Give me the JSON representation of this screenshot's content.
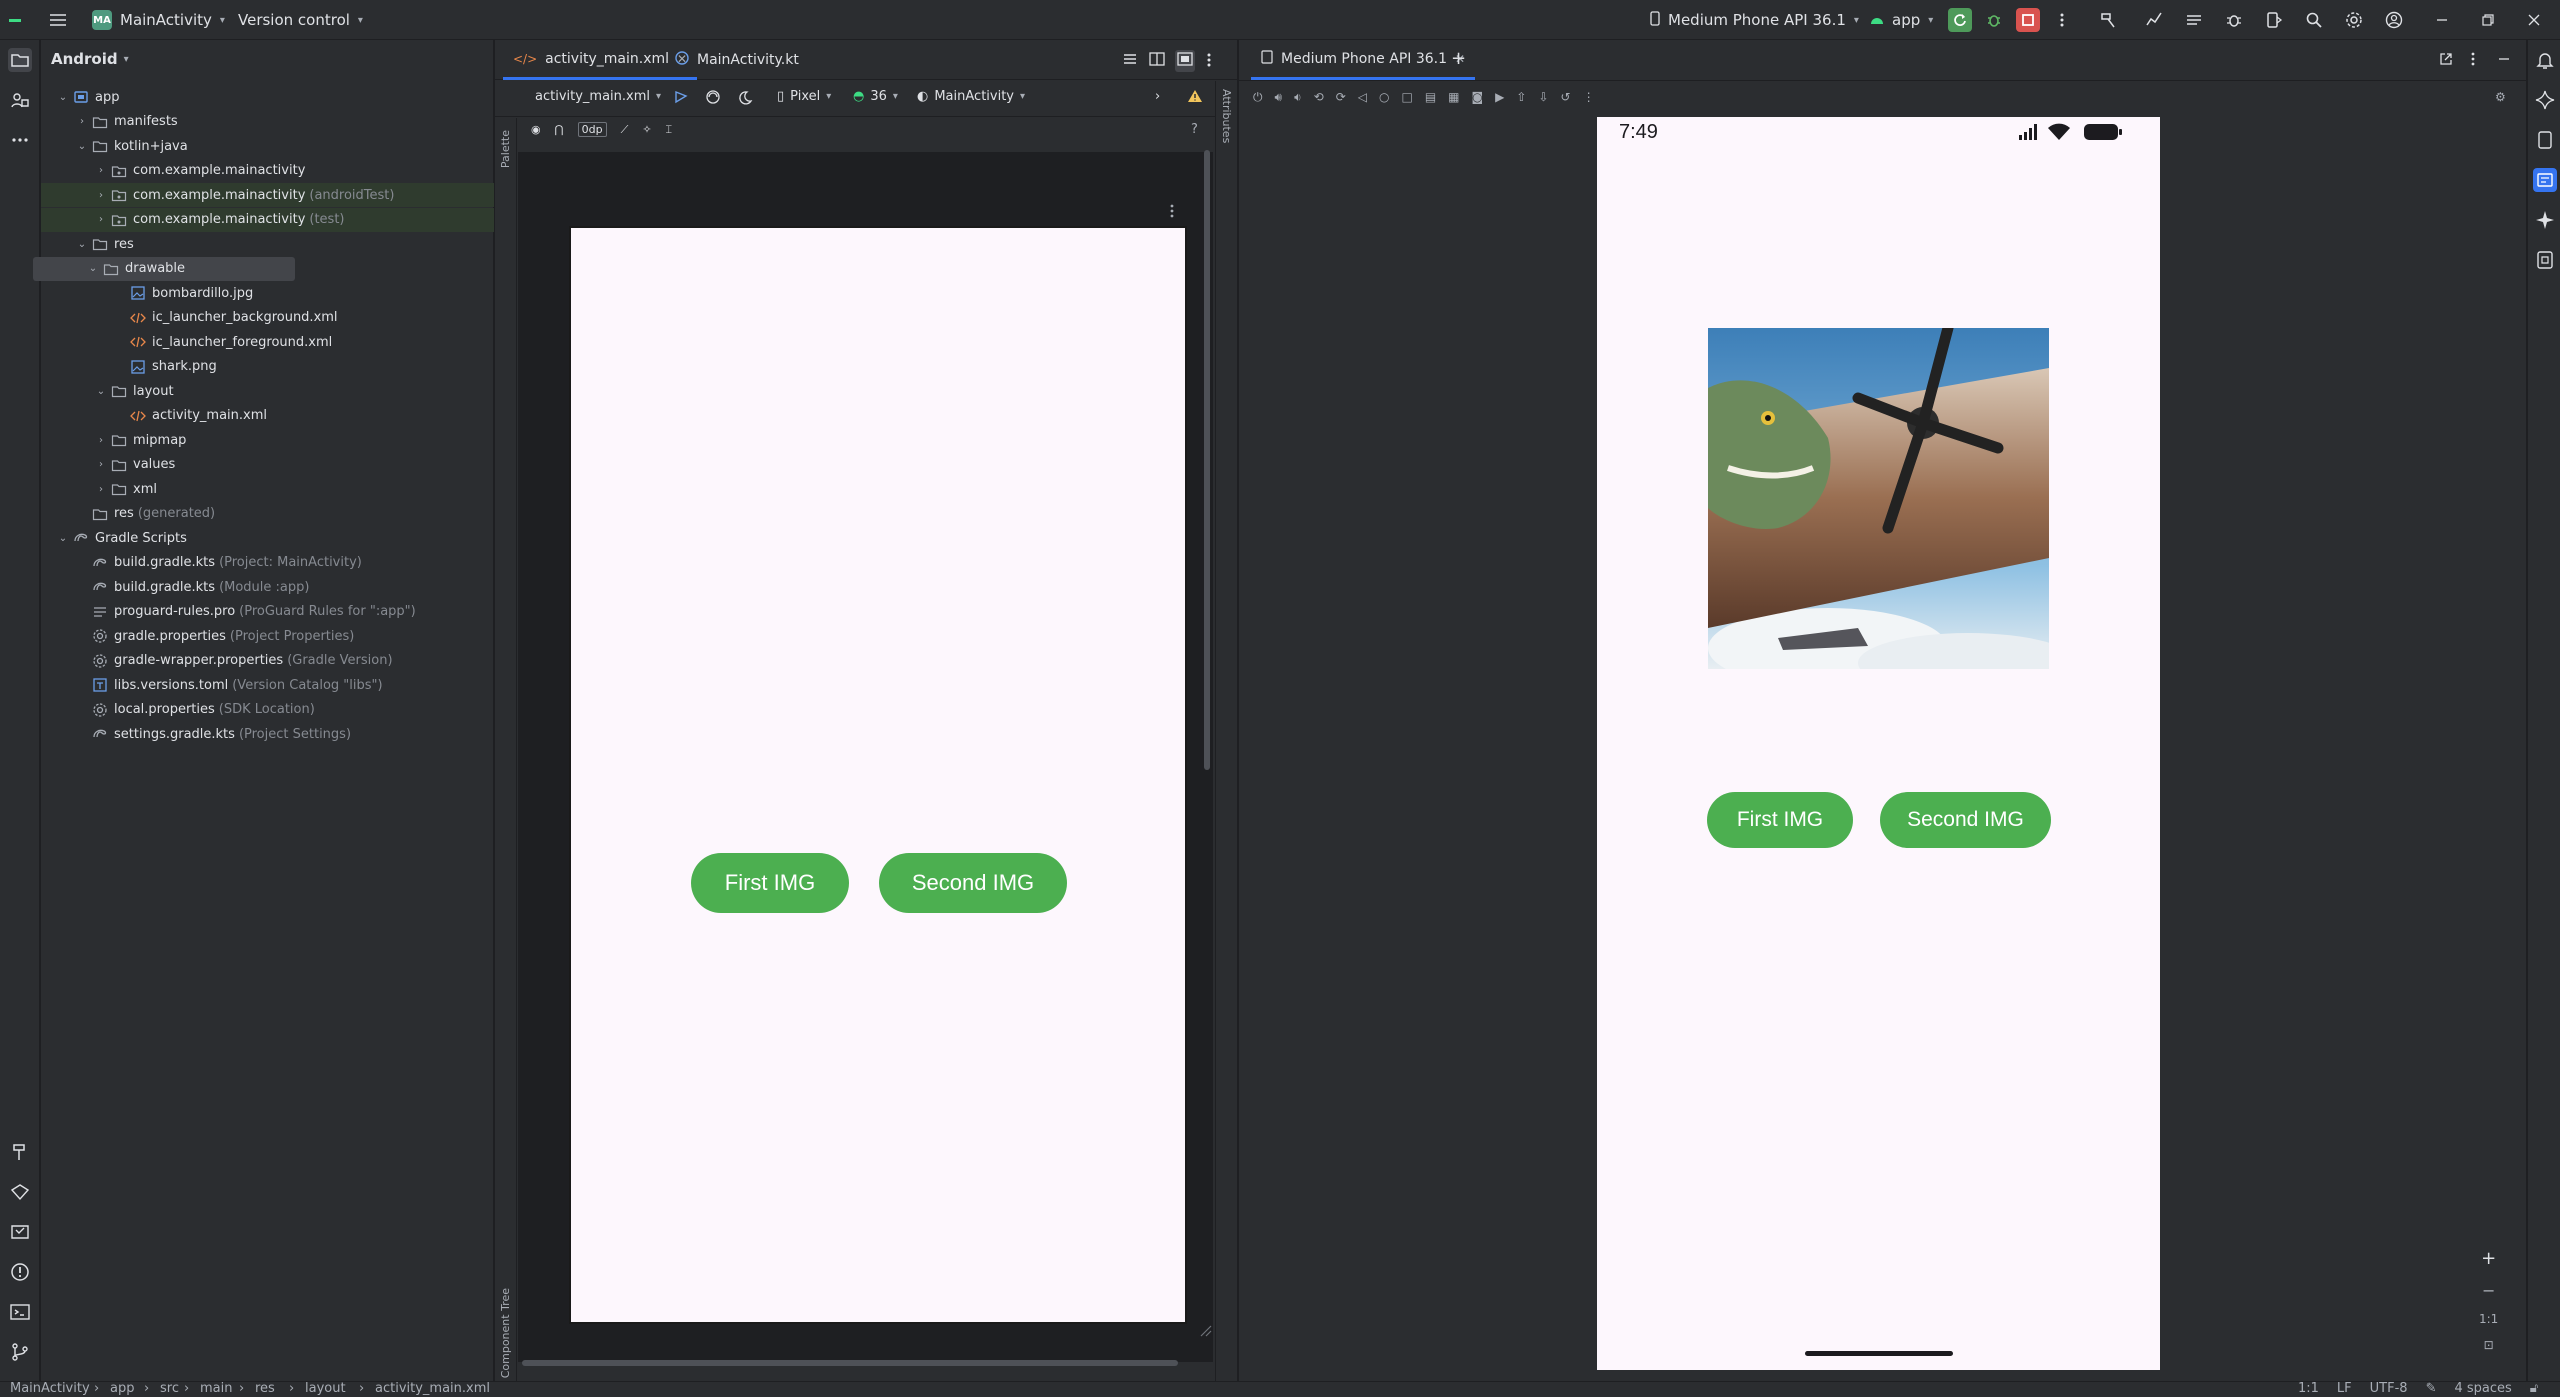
{
  "titlebar": {
    "project_badge": "MA",
    "project_name": "MainActivity",
    "vcs": "Version control",
    "device": "Medium Phone API 36.1",
    "run_config": "app"
  },
  "project_panel": {
    "view": "Android",
    "tree": [
      {
        "label": "app",
        "hint": "",
        "depth": 0,
        "arrow": "open",
        "icon": "module-icon"
      },
      {
        "label": "manifests",
        "hint": "",
        "depth": 1,
        "arrow": "closed",
        "icon": "folder-icon"
      },
      {
        "label": "kotlin+java",
        "hint": "",
        "depth": 1,
        "arrow": "open",
        "icon": "folder-icon"
      },
      {
        "label": "com.example.mainactivity",
        "hint": "",
        "depth": 2,
        "arrow": "closed",
        "icon": "package-icon"
      },
      {
        "label": "com.example.mainactivity",
        "hint": "(androidTest)",
        "depth": 2,
        "arrow": "closed",
        "icon": "package-icon",
        "style": "test"
      },
      {
        "label": "com.example.mainactivity",
        "hint": "(test)",
        "depth": 2,
        "arrow": "closed",
        "icon": "package-icon",
        "style": "test"
      },
      {
        "label": "res",
        "hint": "",
        "depth": 1,
        "arrow": "open",
        "icon": "folder-icon"
      },
      {
        "label": "drawable",
        "hint": "",
        "depth": 2,
        "arrow": "open",
        "icon": "folder-icon",
        "style": "sel"
      },
      {
        "label": "bombardillo.jpg",
        "hint": "",
        "depth": 3,
        "arrow": "none",
        "icon": "image-file-icon"
      },
      {
        "label": "ic_launcher_background.xml",
        "hint": "",
        "depth": 3,
        "arrow": "none",
        "icon": "xml-file-icon"
      },
      {
        "label": "ic_launcher_foreground.xml",
        "hint": "",
        "depth": 3,
        "arrow": "none",
        "icon": "xml-file-icon"
      },
      {
        "label": "shark.png",
        "hint": "",
        "depth": 3,
        "arrow": "none",
        "icon": "image-file-icon"
      },
      {
        "label": "layout",
        "hint": "",
        "depth": 2,
        "arrow": "open",
        "icon": "folder-icon"
      },
      {
        "label": "activity_main.xml",
        "hint": "",
        "depth": 3,
        "arrow": "none",
        "icon": "xml-file-icon"
      },
      {
        "label": "mipmap",
        "hint": "",
        "depth": 2,
        "arrow": "closed",
        "icon": "folder-icon"
      },
      {
        "label": "values",
        "hint": "",
        "depth": 2,
        "arrow": "closed",
        "icon": "folder-icon"
      },
      {
        "label": "xml",
        "hint": "",
        "depth": 2,
        "arrow": "closed",
        "icon": "folder-icon"
      },
      {
        "label": "res",
        "hint": "(generated)",
        "depth": 1,
        "arrow": "none",
        "icon": "folder-icon"
      },
      {
        "label": "Gradle Scripts",
        "hint": "",
        "depth": 0,
        "arrow": "open",
        "icon": "gradle-icon"
      },
      {
        "label": "build.gradle.kts",
        "hint": "(Project: MainActivity)",
        "depth": 1,
        "arrow": "none",
        "icon": "gradle-icon"
      },
      {
        "label": "build.gradle.kts",
        "hint": "(Module :app)",
        "depth": 1,
        "arrow": "none",
        "icon": "gradle-icon"
      },
      {
        "label": "proguard-rules.pro",
        "hint": "(ProGuard Rules for \":app\")",
        "depth": 1,
        "arrow": "none",
        "icon": "text-file-icon"
      },
      {
        "label": "gradle.properties",
        "hint": "(Project Properties)",
        "depth": 1,
        "arrow": "none",
        "icon": "settings-file-icon"
      },
      {
        "label": "gradle-wrapper.properties",
        "hint": "(Gradle Version)",
        "depth": 1,
        "arrow": "none",
        "icon": "settings-file-icon"
      },
      {
        "label": "libs.versions.toml",
        "hint": "(Version Catalog \"libs\")",
        "depth": 1,
        "arrow": "none",
        "icon": "toml-file-icon"
      },
      {
        "label": "local.properties",
        "hint": "(SDK Location)",
        "depth": 1,
        "arrow": "none",
        "icon": "settings-file-icon"
      },
      {
        "label": "settings.gradle.kts",
        "hint": "(Project Settings)",
        "depth": 1,
        "arrow": "none",
        "icon": "gradle-icon"
      }
    ]
  },
  "editor": {
    "tabs": [
      {
        "label": "activity_main.xml",
        "active": true
      },
      {
        "label": "MainActivity.kt",
        "active": false
      }
    ],
    "design_file": "activity_main.xml",
    "device": "Pixel",
    "api": "36",
    "theme": "MainActivity",
    "margin": "0dp",
    "palette_label": "Palette",
    "component_tree_label": "Component Tree",
    "attributes_label": "Attributes",
    "help": "?"
  },
  "design_preview": {
    "first_button": "First IMG",
    "second_button": "Second IMG"
  },
  "emulator": {
    "tab_label": "Medium Phone API 36.1",
    "time": "7:49",
    "first_button": "First IMG",
    "second_button": "Second IMG",
    "zoom_ratio": "1:1"
  },
  "statusbar": {
    "breadcrumbs": [
      "MainActivity",
      "app",
      "src",
      "main",
      "res",
      "layout",
      "activity_main.xml"
    ],
    "position": "1:1",
    "line_sep": "LF",
    "encoding": "UTF-8",
    "indent": "4 spaces"
  }
}
